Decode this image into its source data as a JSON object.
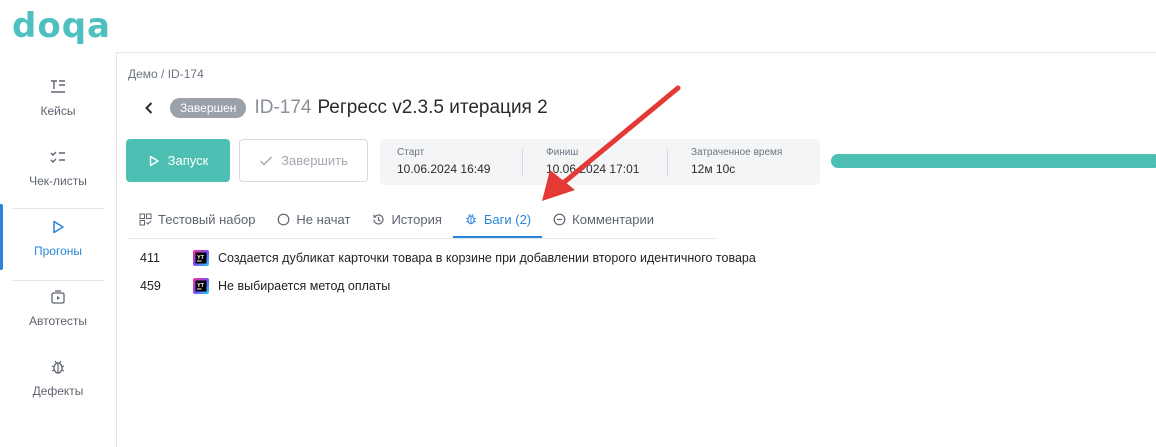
{
  "logo": {
    "text": "doqa"
  },
  "sidebar": {
    "items": [
      {
        "label": "Кейсы",
        "icon": "cases-icon"
      },
      {
        "label": "Чек-листы",
        "icon": "checklist-icon"
      },
      {
        "label": "Прогоны",
        "icon": "play-icon",
        "active": true
      },
      {
        "label": "Автотесты",
        "icon": "autotest-icon"
      },
      {
        "label": "Дефекты",
        "icon": "bug-icon"
      }
    ]
  },
  "breadcrumb": "Демо / ID-174",
  "header": {
    "status_badge": "Завершен",
    "run_id": "ID-174",
    "title": "Регресс v2.3.5 итерация 2"
  },
  "toolbar": {
    "run_label": "Запуск",
    "finish_label": "Завершить"
  },
  "info": {
    "start_label": "Старт",
    "start_value": "10.06.2024 16:49",
    "finish_label": "Финиш",
    "finish_value": "10.06.2024 17:01",
    "elapsed_label": "Затраченное время",
    "elapsed_value": "12м 10с"
  },
  "progress": {
    "percent": 100,
    "color": "#4dbfb3"
  },
  "tabs": [
    {
      "label": "Тестовый набор"
    },
    {
      "label": "Не начат"
    },
    {
      "label": "История"
    },
    {
      "label": "Баги (2)",
      "active": true
    },
    {
      "label": "Комментарии"
    }
  ],
  "bugs": [
    {
      "id": "411",
      "title": "Создается дубликат карточки товара в корзине при добавлении второго идентичного товара"
    },
    {
      "id": "459",
      "title": "Не выбирается метод оплаты"
    }
  ],
  "colors": {
    "accent": "#2a86d8",
    "brand": "#4dbfb3",
    "arrow": "#e53935"
  }
}
